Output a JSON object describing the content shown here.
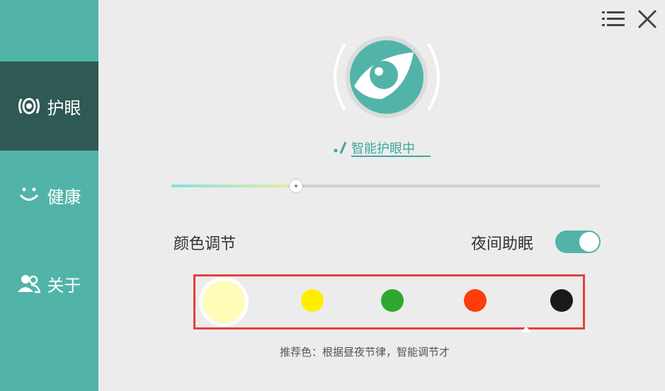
{
  "sidebar": {
    "items": [
      {
        "label": "护眼",
        "icon": "eye-protect-icon",
        "active": true
      },
      {
        "label": "健康",
        "icon": "smile-icon",
        "active": false
      },
      {
        "label": "关于",
        "icon": "users-icon",
        "active": false
      }
    ]
  },
  "header": {
    "menu_icon": "menu-icon",
    "close_icon": "close-icon"
  },
  "status": {
    "text": "智能护眼中"
  },
  "slider": {
    "value": 0.29
  },
  "color_section": {
    "label": "颜色调节",
    "night_label": "夜间助眠",
    "night_on": true,
    "swatches": [
      "#fffbb8",
      "#ffee00",
      "#2ea82e",
      "#ff3c0a",
      "#1a1a1a"
    ],
    "selected_index": 0
  },
  "tip": {
    "text": "推荐色：根据昼夜节律，智能调节才"
  },
  "colors": {
    "accent": "#52b4a9",
    "sidebar_active": "#2e5954",
    "highlight": "#e3413c"
  }
}
